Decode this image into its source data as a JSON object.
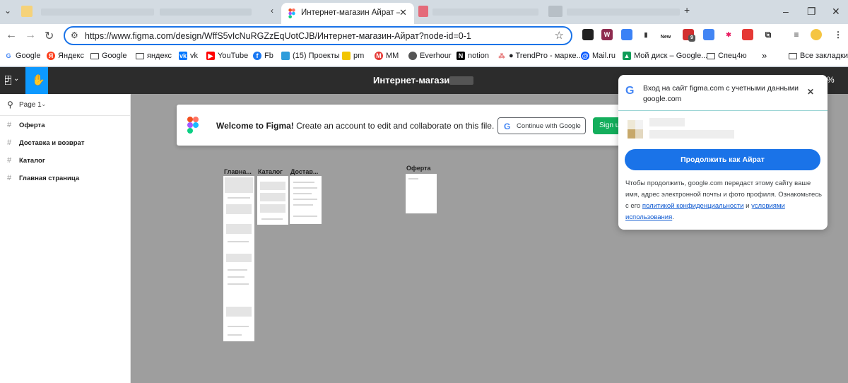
{
  "browser": {
    "active_tab_title": "Интернет-магазин Айрат – Fig",
    "url": "https://www.figma.com/design/WffS5vIcNuRGZzEqUotCJB/Интернет-магазин-Айрат?node-id=0-1",
    "window_controls": {
      "minimize": "–",
      "restore": "❐",
      "close": "✕"
    },
    "extension_badges": {
      "new": "New",
      "count": "9"
    }
  },
  "bookmarks": [
    {
      "label": "Google",
      "icon": "google-icon",
      "color": "#4285f4"
    },
    {
      "label": "Яндекс",
      "icon": "yandex-icon",
      "color": "#fc3f1d"
    },
    {
      "label": "Google",
      "icon": "folder-icon"
    },
    {
      "label": "яндекс",
      "icon": "folder-icon"
    },
    {
      "label": "vk",
      "icon": "vk-icon",
      "color": "#0077ff"
    },
    {
      "label": "YouTube",
      "icon": "youtube-icon",
      "color": "#ff0000"
    },
    {
      "label": "Fb",
      "icon": "facebook-icon",
      "color": "#1877f2"
    },
    {
      "label": "(15) Проекты",
      "icon": "projects-icon",
      "color": "#2d9cdb"
    },
    {
      "label": "pm",
      "icon": "pm-icon",
      "color": "#f2c500"
    },
    {
      "label": "ММ",
      "icon": "mm-icon",
      "color": "#e53935"
    },
    {
      "label": "Everhour",
      "icon": "everhour-icon",
      "color": "#555555"
    },
    {
      "label": "notion",
      "icon": "notion-icon",
      "color": "#000000"
    },
    {
      "label": "● TrendPro - марке...",
      "icon": "trendpro-icon",
      "color": "#e57373"
    },
    {
      "label": "Mail.ru",
      "icon": "mailru-icon",
      "color": "#0055ff"
    },
    {
      "label": "Мой диск – Google...",
      "icon": "google-drive-icon",
      "color": "#0f9d58"
    },
    {
      "label": "Спец4ю",
      "icon": "folder-icon"
    }
  ],
  "bookmarks_overflow": "»",
  "all_bookmarks": "Все закладки",
  "figma": {
    "file_title": "Интернет-магазин",
    "zoom": "%",
    "page_selector": "Page 1",
    "layers": [
      "Оферта",
      "Доставка и возврат",
      "Каталог",
      "Главная страница"
    ],
    "welcome": {
      "bold": "Welcome to Figma!",
      "text": " Create an account to edit and collaborate on this file.",
      "continue_google": "Continue with Google",
      "sign_up": "Sign up"
    },
    "frames": [
      {
        "label": "Главна..."
      },
      {
        "label": "Каталог"
      },
      {
        "label": "Достав..."
      },
      {
        "label": "Оферта"
      }
    ]
  },
  "gsi": {
    "header": "Вход на сайт figma.com с учетными данными google.com",
    "continue": "Продолжить как Айрат",
    "body_pre": "Чтобы продолжить, google.com передаст этому сайту ваше имя, адрес электронной почты и фото профиля. Ознакомьтесь с его ",
    "privacy_link": "политикой конфиденциальности",
    "body_and": " и ",
    "terms_link": "условиями использования",
    "body_end": "."
  },
  "colors": {
    "accent": "#1a73e8",
    "figma_header": "#2c2c2c",
    "figma_blue": "#0d99ff",
    "signup_green": "#14ae5c",
    "canvas": "#9e9e9e"
  }
}
